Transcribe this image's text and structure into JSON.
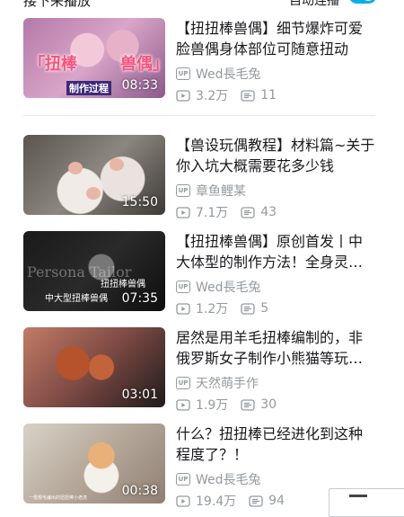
{
  "header": {
    "title": "接下来播放",
    "autoplay_label": "自动连播",
    "autoplay_on": true,
    "accent_color": "#00aeec"
  },
  "videos": [
    {
      "title": "【扭扭棒兽偶】细节爆炸可爱脸兽偶身体部位可随意扭动",
      "uploader": "Wed長毛兔",
      "plays": "3.2万",
      "danmaku": "11",
      "duration": "08:33",
      "thumb_text": [
        "「扭棒",
        "兽偶」"
      ],
      "thumb_sub": "制作过程"
    },
    {
      "title": "【兽设玩偶教程】材料篇~关于你入坑大概需要花多少钱",
      "uploader": "章鱼鲤某",
      "plays": "7.1万",
      "danmaku": "43",
      "duration": "15:50"
    },
    {
      "title": "【扭扭棒兽偶】原创首发丨中大体型的制作方法！全身灵…",
      "uploader": "Wed長毛兔",
      "plays": "1.2万",
      "danmaku": "5",
      "duration": "07:35",
      "thumb_text": [
        "Persona Tailor",
        "中大型扭棒兽偶",
        "扭扭棒兽偶"
      ]
    },
    {
      "title": "居然是用羊毛扭棒编制的，非俄罗斯女子制作小熊猫等玩…",
      "uploader": "天然萌手作",
      "plays": "1.9万",
      "danmaku": "30",
      "duration": "03:01"
    },
    {
      "title": "什么？扭扭棒已经进化到这种程度了？！",
      "uploader": "Wed長毛兔",
      "plays": "19.4万",
      "danmaku": "94",
      "duration": "00:38",
      "thumb_footnote": "一根根毛编出的扭扭棒小老虎"
    }
  ],
  "icons": {
    "uploader": "up-icon",
    "plays": "play-count-icon",
    "danmaku": "danmaku-icon"
  },
  "up_badge": "UP"
}
